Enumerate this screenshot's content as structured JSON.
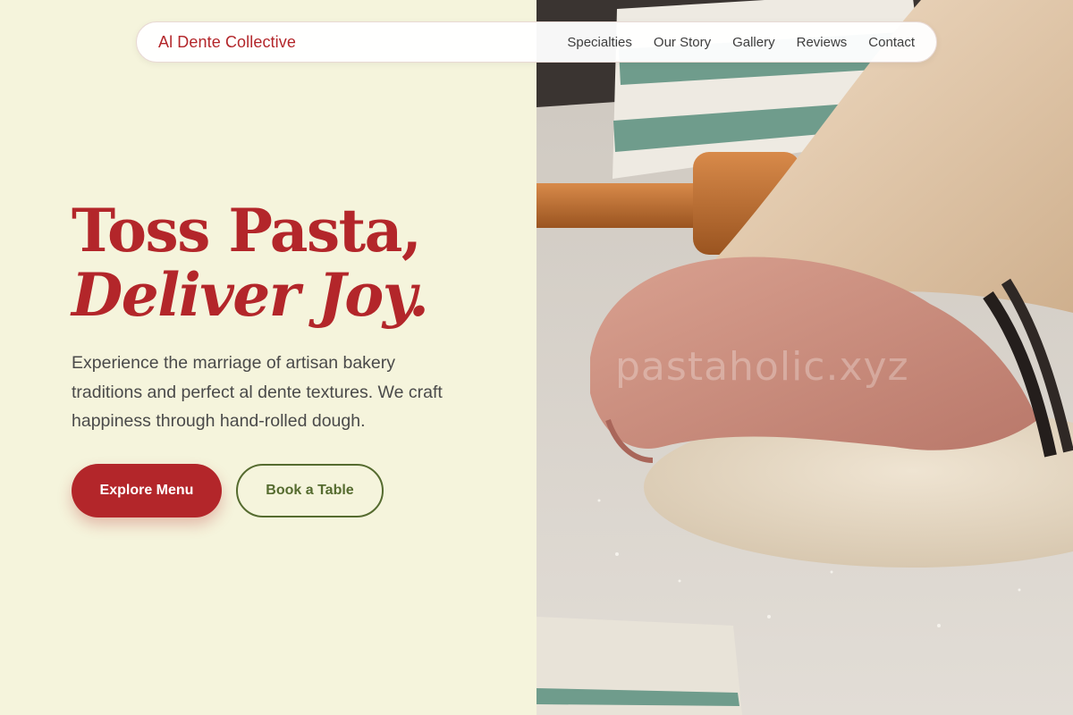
{
  "brand": {
    "name": "Al Dente Collective"
  },
  "nav": {
    "links": [
      "Specialties",
      "Our Story",
      "Gallery",
      "Reviews",
      "Contact"
    ]
  },
  "hero": {
    "headline_line1": "Toss Pasta,",
    "headline_line2": "Deliver Joy.",
    "description": "Experience the marriage of artisan bakery traditions and perfect al dente textures. We craft happiness through hand-rolled dough.",
    "primary_button": "Explore Menu",
    "secondary_button": "Book a Table"
  },
  "image": {
    "subject": "hands kneading pasta dough on a floured surface",
    "watermark": "pastaholic.xyz"
  },
  "colors": {
    "background": "#f5f4dc",
    "accent": "#b3262a",
    "secondary": "#556b2f",
    "text": "#4a4a4a"
  }
}
